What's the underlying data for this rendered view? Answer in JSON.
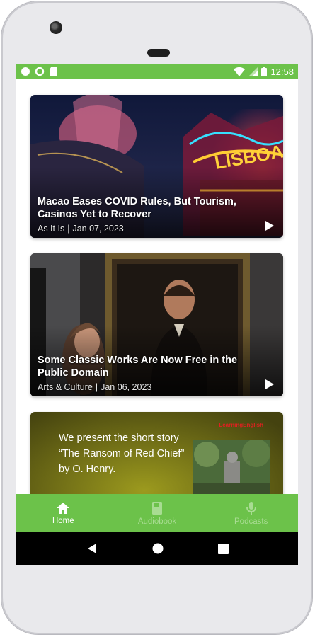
{
  "status_bar": {
    "time": "12:58",
    "left_icons": [
      "circle-icon",
      "ring-icon",
      "sd-card-icon"
    ],
    "right_icons": [
      "wifi-icon",
      "signal-icon",
      "battery-icon"
    ]
  },
  "feed": {
    "cards": [
      {
        "title": "Macao Eases COVID Rules, But Tourism, Casinos Yet to Recover",
        "category": "As It Is",
        "separator": "|",
        "date": "Jan 07, 2023",
        "icon": "play-icon"
      },
      {
        "title": "Some Classic Works Are Now Free in the Public Domain",
        "category": "Arts & Culture",
        "separator": "|",
        "date": "Jan 06, 2023",
        "icon": "play-icon"
      },
      {
        "text": "We present the short story “The Ransom of Red Chief” by O. Henry.",
        "brand": "LearningEnglish"
      }
    ]
  },
  "bottom_nav": {
    "items": [
      {
        "label": "Home",
        "icon": "home-icon",
        "active": true
      },
      {
        "label": "Audiobook",
        "icon": "book-icon",
        "active": false
      },
      {
        "label": "Podcasts",
        "icon": "microphone-icon",
        "active": false
      }
    ]
  },
  "system_nav": {
    "icons": [
      "back-icon",
      "home-circle-icon",
      "recents-icon"
    ]
  },
  "colors": {
    "accent_green": "#6cc24a",
    "inactive_nav": "#a8dc92"
  }
}
